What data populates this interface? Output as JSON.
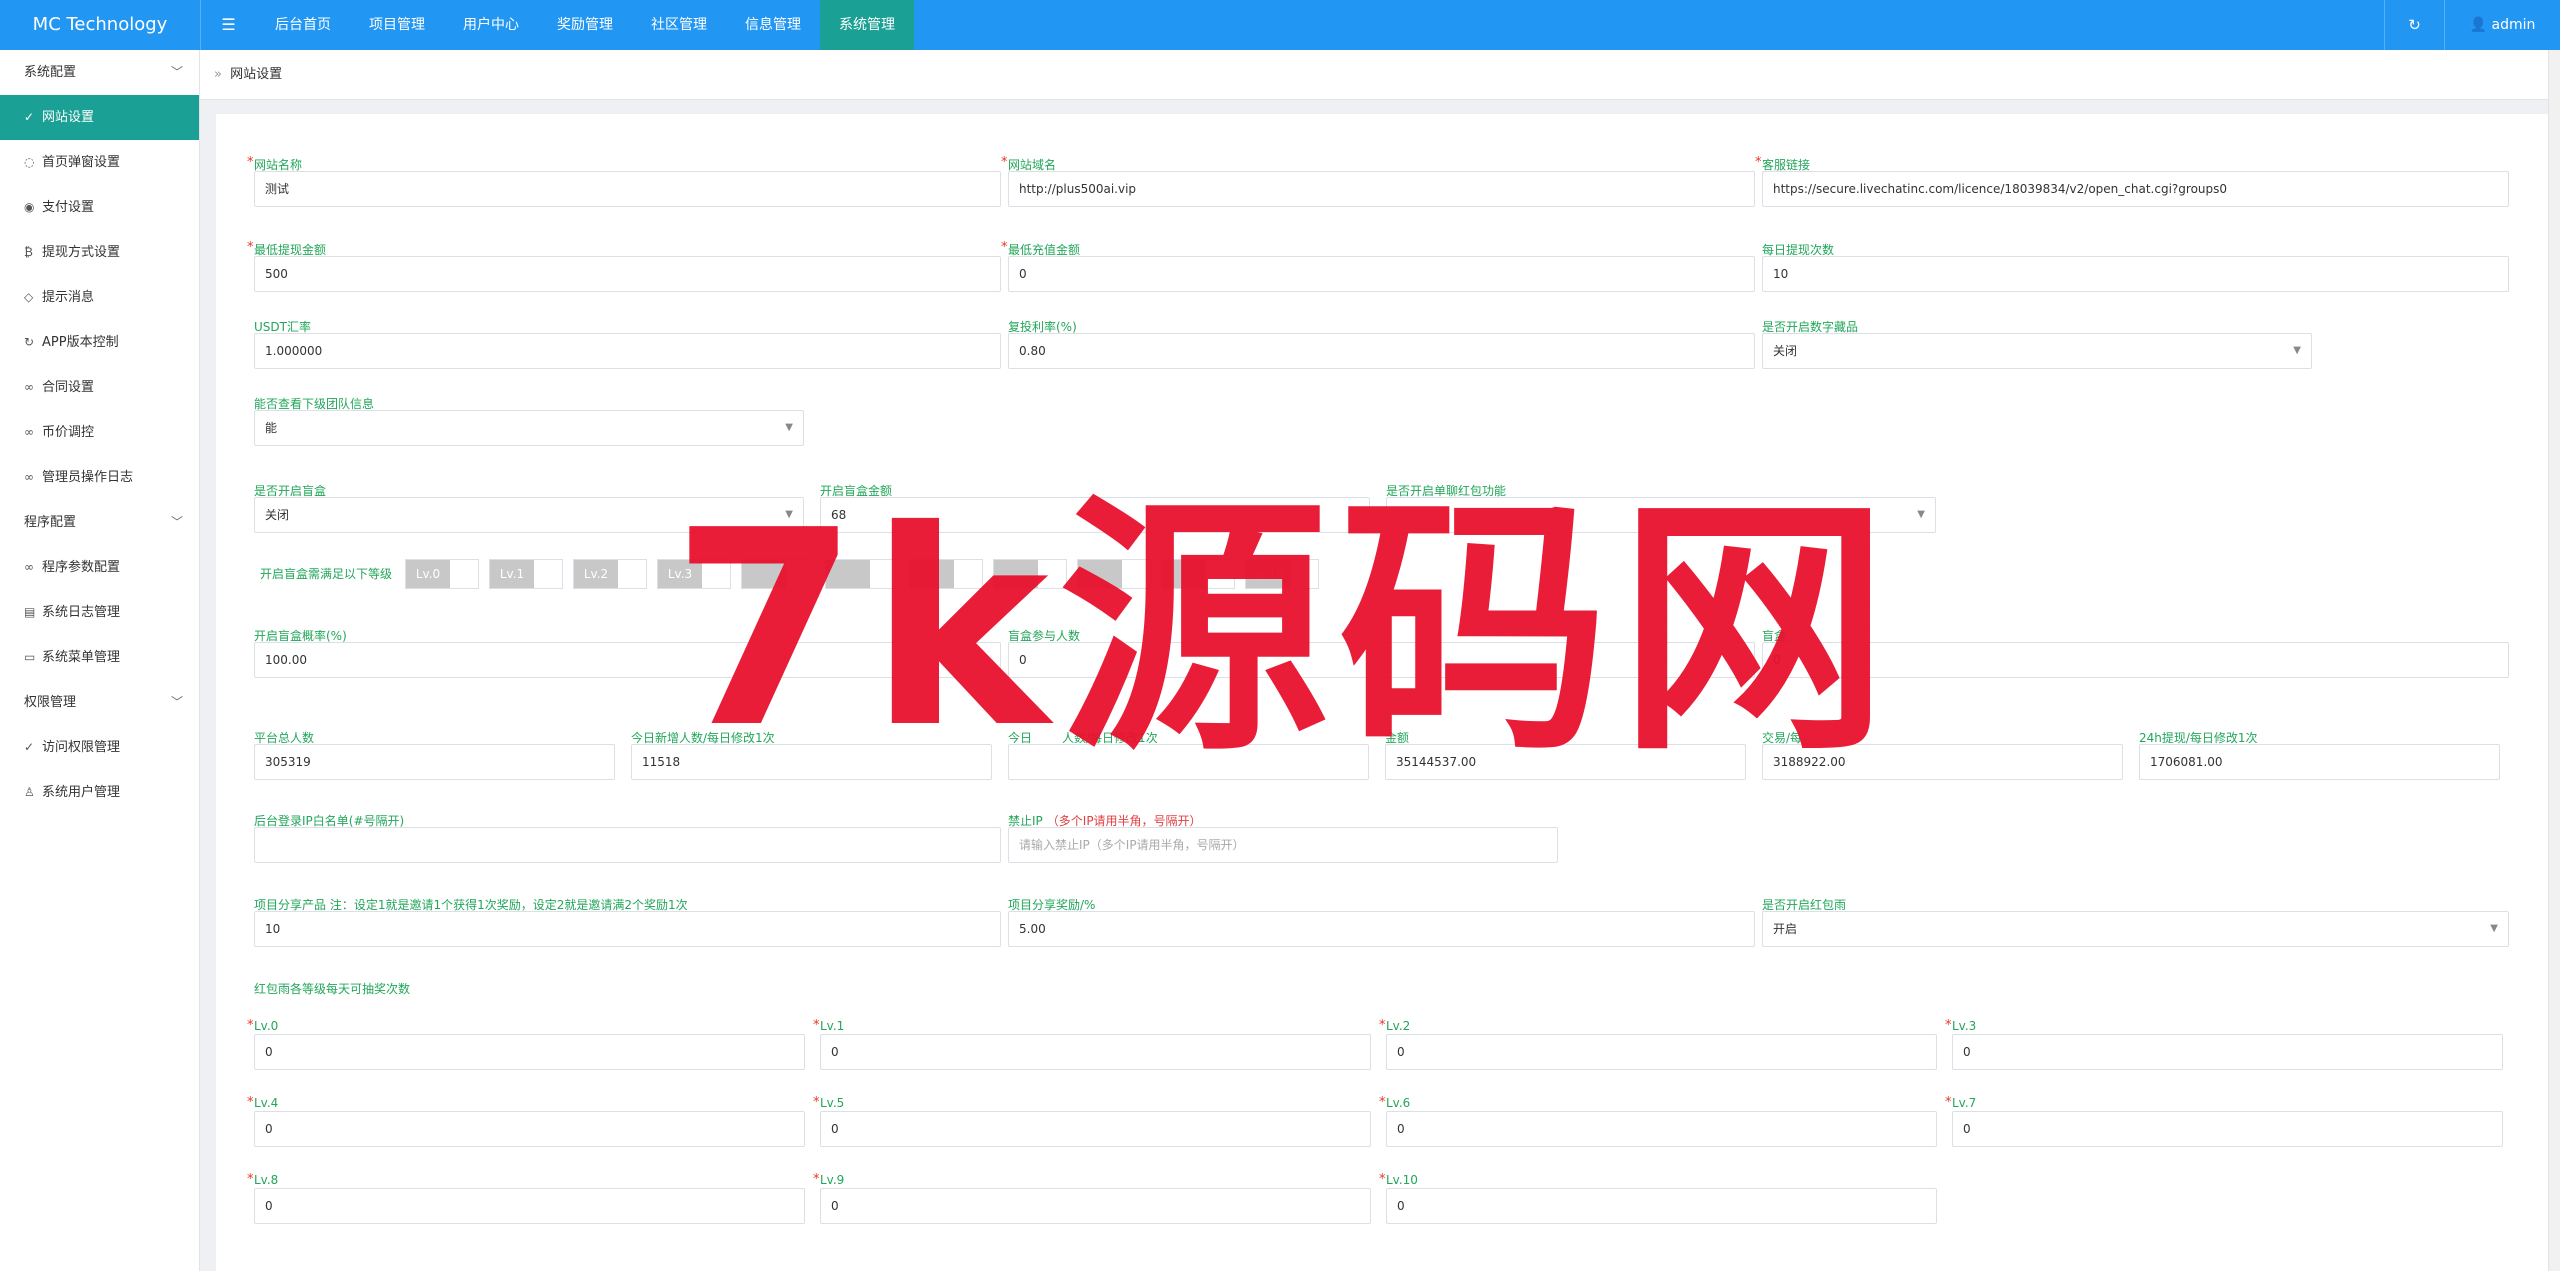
{
  "header": {
    "brand": "MC Technology",
    "menu_toggle": "☰",
    "nav": [
      "后台首页",
      "项目管理",
      "用户中心",
      "奖励管理",
      "社区管理",
      "信息管理",
      "系统管理"
    ],
    "active_nav": "系统管理",
    "refresh": "↻",
    "user": "👤 admin",
    "accent_color": "#2196f3",
    "active_color": "#1aa094"
  },
  "sidebar": {
    "groups": [
      {
        "label": "系统配置",
        "items": [
          {
            "label": "网站设置",
            "icon": "gear-icon",
            "glyph": "✓",
            "active": true
          },
          {
            "label": "首页弹窗设置",
            "icon": "comment-icon",
            "glyph": "◌"
          },
          {
            "label": "支付设置",
            "icon": "payment-icon",
            "glyph": "◉"
          },
          {
            "label": "提现方式设置",
            "icon": "bitcoin-icon",
            "glyph": "₿"
          },
          {
            "label": "提示消息",
            "icon": "tag-icon",
            "glyph": "◇"
          },
          {
            "label": "APP版本控制",
            "icon": "refresh-icon",
            "glyph": "↻"
          },
          {
            "label": "合同设置",
            "icon": "link-icon",
            "glyph": "∞"
          },
          {
            "label": "币价调控",
            "icon": "link-icon",
            "glyph": "∞"
          },
          {
            "label": "管理员操作日志",
            "icon": "link-icon",
            "glyph": "∞"
          }
        ]
      },
      {
        "label": "程序配置",
        "items": [
          {
            "label": "程序参数配置",
            "icon": "link-icon",
            "glyph": "∞"
          },
          {
            "label": "系统日志管理",
            "icon": "document-icon",
            "glyph": "▤"
          },
          {
            "label": "系统菜单管理",
            "icon": "menu-icon",
            "glyph": "▭"
          }
        ]
      },
      {
        "label": "权限管理",
        "items": [
          {
            "label": "访问权限管理",
            "icon": "shield-check-icon",
            "glyph": "✓"
          },
          {
            "label": "系统用户管理",
            "icon": "user-icon",
            "glyph": "♙"
          }
        ]
      }
    ]
  },
  "breadcrumb": {
    "sep": "»",
    "label": "网站设置"
  },
  "form": {
    "site_name": {
      "label": "网站名称",
      "value": "测试"
    },
    "site_domain": {
      "label": "网站域名",
      "value": "http://plus500ai.vip"
    },
    "service_link": {
      "label": "客服链接",
      "value": "https://secure.livechatinc.com/licence/18039834/v2/open_chat.cgi?groups0"
    },
    "min_withdraw": {
      "label": "最低提现金额",
      "value": "500"
    },
    "min_recharge": {
      "label": "最低充值金额",
      "value": "0"
    },
    "daily_withdraw_count": {
      "label": "每日提现次数",
      "value": "10"
    },
    "usdt_rate": {
      "label": "USDT汇率",
      "value": "1.000000"
    },
    "reinvest_rate": {
      "label": "复投利率(%)",
      "value": "0.80"
    },
    "digital_collection": {
      "label": "是否开启数字藏品",
      "value": "关闭"
    },
    "view_team": {
      "label": "能否查看下级团队信息",
      "value": "能"
    },
    "blind_box": {
      "label": "是否开启盲盒",
      "value": "关闭"
    },
    "blind_box_amount": {
      "label": "开启盲盒金额",
      "value": "68"
    },
    "single_redpacket": {
      "label": "是否开启单聊红包功能",
      "value": ""
    },
    "blind_box_levels": {
      "label": "开启盲盒需满足以下等级",
      "levels": [
        "Lv.0",
        "Lv.1",
        "Lv.2",
        "Lv.3",
        "",
        "",
        "",
        "",
        "",
        "",
        "Lv.10"
      ]
    },
    "blind_box_prob": {
      "label": "开启盲盒概率(%)",
      "value": "100.00"
    },
    "blind_box_participants": {
      "label": "盲盒参与人数",
      "value": "0"
    },
    "blind_box_misc": {
      "label": "盲盒",
      "value": "0"
    },
    "total_users": {
      "label": "平台总人数",
      "value": "305319"
    },
    "today_new_users": {
      "label": "今日新增人数/每日修改1次",
      "value": "11518"
    },
    "today_active": {
      "label": "今日",
      "label_tail": "人数/每日修改1次",
      "value": ""
    },
    "total_amount": {
      "label": "金额",
      "value": "35144537.00"
    },
    "trade_amount": {
      "label": "交易/每",
      "value": "3188922.00"
    },
    "withdraw_24h": {
      "label": "24h提现/每日修改1次",
      "value": "1706081.00"
    },
    "login_ip_whitelist": {
      "label": "后台登录IP白名单(#号隔开)",
      "value": ""
    },
    "ip_blacklist": {
      "label": "禁止IP",
      "hint": "（多个IP请用半角，号隔开）",
      "placeholder": "请输入禁止IP（多个IP请用半角，号隔开）"
    },
    "project_share": {
      "label": "项目分享产品 注：设定1就是邀请1个获得1次奖励，设定2就是邀请满2个奖励1次",
      "value": "10"
    },
    "project_share_reward": {
      "label": "项目分享奖励/%",
      "value": "5.00"
    },
    "redpacket_rain": {
      "label": "是否开启红包雨",
      "value": "开启"
    },
    "redpacket_draws": {
      "label": "红包雨各等级每天可抽奖次数",
      "levels": [
        {
          "label": "Lv.0",
          "value": "0"
        },
        {
          "label": "Lv.1",
          "value": "0"
        },
        {
          "label": "Lv.2",
          "value": "0"
        },
        {
          "label": "Lv.3",
          "value": "0"
        },
        {
          "label": "Lv.4",
          "value": "0"
        },
        {
          "label": "Lv.5",
          "value": "0"
        },
        {
          "label": "Lv.6",
          "value": "0"
        },
        {
          "label": "Lv.7",
          "value": "0"
        },
        {
          "label": "Lv.8",
          "value": "0"
        },
        {
          "label": "Lv.9",
          "value": "0"
        },
        {
          "label": "Lv.10",
          "value": "0"
        }
      ]
    }
  },
  "watermark": {
    "text": "7k源码网",
    "color": "#e8112d"
  }
}
